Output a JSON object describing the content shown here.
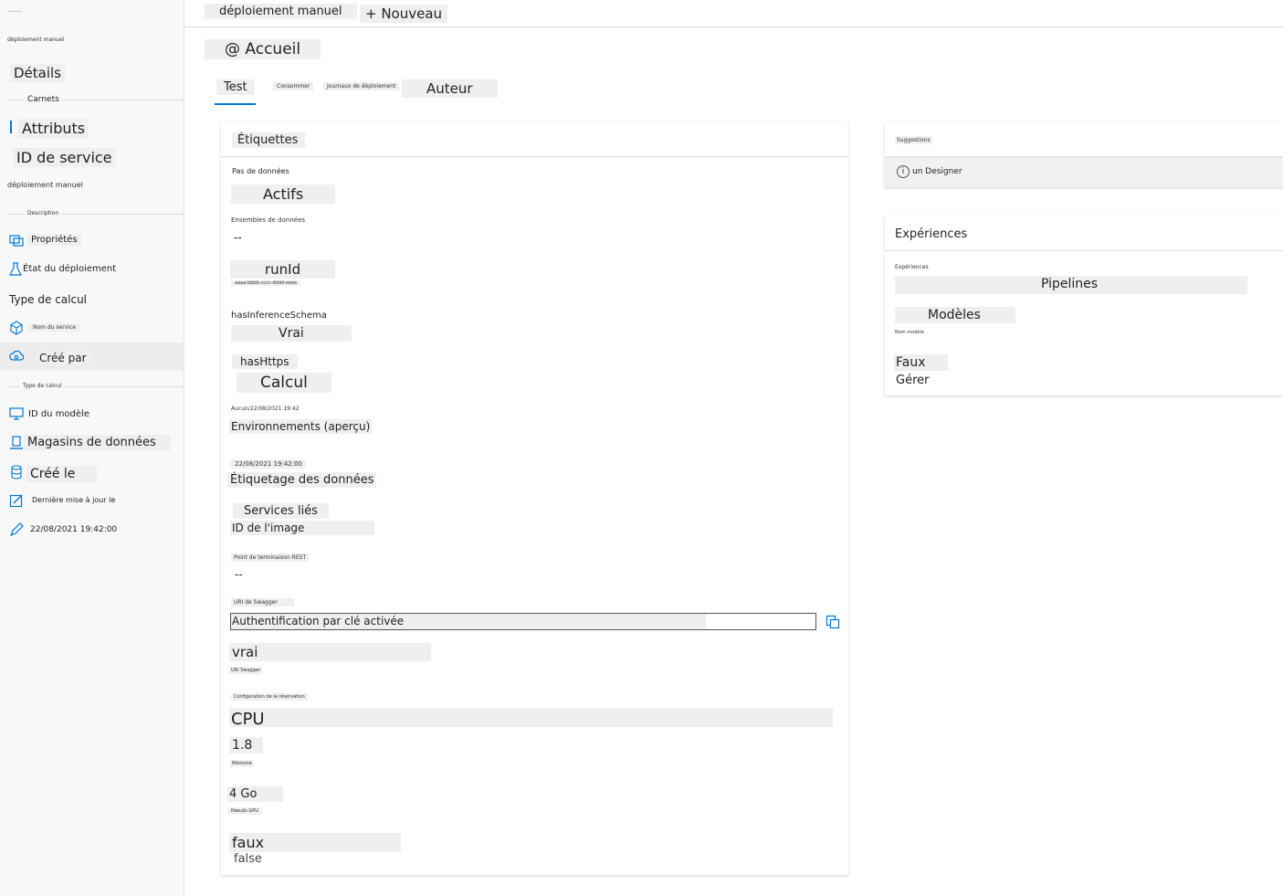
{
  "sidebar": {
    "top_tiny": "........",
    "workspace": "déploiement manuel",
    "items_top": {
      "details": "Détails",
      "section_notebooks": "Carnets",
      "attributes": "Attributs",
      "service_id": "ID de service",
      "deploy_manual": "déploiement manuel",
      "section_desc": "Description"
    },
    "nav": [
      {
        "label": "Propriétés",
        "icon": "properties-icon"
      },
      {
        "label": "État du déploiement",
        "icon": "flask-icon"
      },
      {
        "label": "Type de calcul",
        "icon": ""
      },
      {
        "label": "Nom du service",
        "icon": "cube-icon"
      },
      {
        "label": "Créé par",
        "icon": "cloud-deploy-icon"
      }
    ],
    "section_tiny": "Type de calcul",
    "nav2": [
      {
        "label": "ID du modèle",
        "icon": "monitor-icon"
      },
      {
        "label": "Magasins de données",
        "icon": "datastore-icon"
      },
      {
        "label": "Créé le",
        "icon": "database-icon"
      },
      {
        "label": "Dernière mise à jour le",
        "icon": "edit-icon"
      },
      {
        "label": "22/08/2021 19:42:00",
        "icon": "pen-icon"
      }
    ]
  },
  "topbar": {
    "breadcrumb": "déploiement manuel",
    "new_button": "+ Nouveau"
  },
  "page_title": "@ Accueil",
  "tabs": [
    "Test",
    "Consommer",
    "Journaux de déploiement",
    "Auteur"
  ],
  "details_card": {
    "header": "Étiquettes",
    "fields": {
      "f1_label": "Pas de données",
      "f1_value": "Actifs",
      "f2_label": "Ensembles de données",
      "f2_value": "--",
      "f3_value": "runId",
      "f3_sub": "aaaa-bbbb-cccc-dddd-eeee",
      "f4_label": "hasInferenceSchema",
      "f4_value": "Vrai",
      "f5_label": "hasHttps",
      "f5_value": "Calcul",
      "f6_label": "Aucun/22/08/2021 19:42",
      "f6_value": "Environnements (aperçu)",
      "f7_label": "22/08/2021 19:42:00",
      "f7_value": "Étiquetage des données",
      "f8_label": "Services liés",
      "f8_value": "ID de l'image",
      "f9_label": "Point de terminaison REST",
      "f9_value": "--",
      "f10_label": "URI de Swagger",
      "f10_value": "Authentification par clé activée",
      "f11_value": "vrai",
      "f11_sub": "URI Swagger",
      "f12_label": "Configuration de la réservation",
      "f12_value": "CPU",
      "f13_value": "1.8",
      "f13_sub": "Mémoire",
      "f14_value": "4 Go",
      "f14_sub": "Nœuds GPU",
      "f15_value": "faux",
      "f15_sub": "false"
    }
  },
  "info_card": {
    "tiny": "Suggestions",
    "designer": "un Designer"
  },
  "experiments_card": {
    "header": "Expériences",
    "tiny1": "Expériences",
    "pipelines": "Pipelines",
    "models": "Modèles",
    "tiny2": "Nom modèle",
    "faux": "Faux",
    "manage": "Gérer"
  },
  "colors": {
    "accent": "#0078d4",
    "sidebar_bg": "#f8f8f8",
    "label_bg": "#efefef"
  }
}
